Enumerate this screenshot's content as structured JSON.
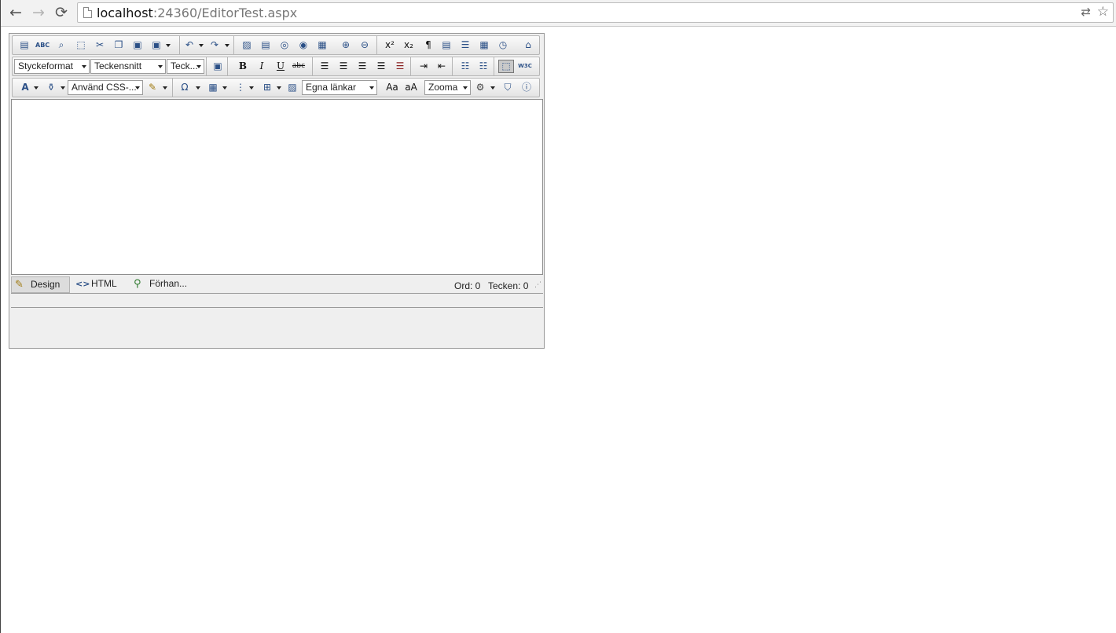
{
  "browser": {
    "url_host": "localhost",
    "url_rest": ":24360/EditorTest.aspx",
    "back_glyph": "←",
    "forward_glyph": "→",
    "reload_glyph": "⟳",
    "translate_glyph": "⇄",
    "star_glyph": "☆"
  },
  "toolbar1": {
    "superscript_label": "x²",
    "subscript_label": "x₂",
    "paragraph_label": "¶",
    "spell_label": "ABC"
  },
  "toolbar2": {
    "paragraph_style": "Styckeformat",
    "font_name": "Teckensnitt",
    "font_size": "Teck...",
    "bold_label": "B",
    "italic_label": "I",
    "underline_label": "U",
    "strike_label": "abc",
    "w3c_label": "W3C"
  },
  "toolbar3": {
    "fore_color_label": "A",
    "css_class": "Använd CSS-...",
    "omega_label": "Ω",
    "custom_links": "Egna länkar",
    "zoom": "Zooma"
  },
  "modes": {
    "design": "Design",
    "html": "HTML",
    "preview": "Förhan..."
  },
  "stats": {
    "words": "Ord: 0",
    "chars": "Tecken: 0"
  },
  "colors": {
    "toolbar_icon": "#2a4f86",
    "editor_bg": "#efefef",
    "content_bg": "#ffffff"
  }
}
